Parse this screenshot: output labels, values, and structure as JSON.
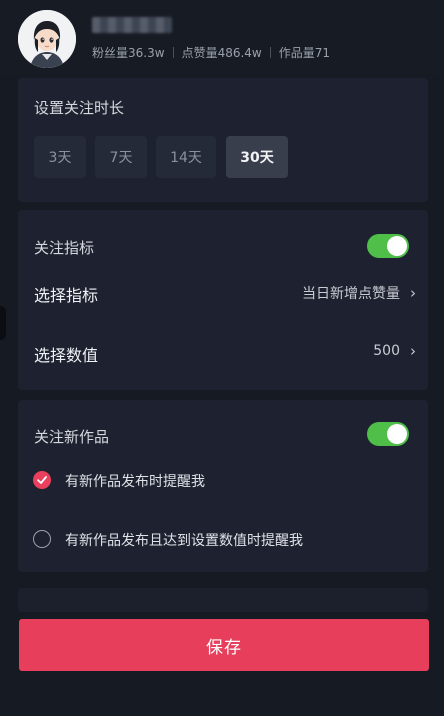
{
  "profile": {
    "stats": [
      {
        "label": "粉丝量",
        "value": "36.3w"
      },
      {
        "label": "点赞量",
        "value": "486.4w"
      },
      {
        "label": "作品量",
        "value": "71"
      }
    ]
  },
  "duration": {
    "title": "设置关注时长",
    "options": [
      "3天",
      "7天",
      "14天",
      "30天"
    ],
    "selected": "30天"
  },
  "metric": {
    "toggle_label": "关注指标",
    "toggle_on": true,
    "select_label": "选择指标",
    "select_value": "当日新增点赞量",
    "value_label": "选择数值",
    "value_value": "500"
  },
  "new_works": {
    "toggle_label": "关注新作品",
    "toggle_on": true,
    "options": [
      {
        "label": "有新作品发布时提醒我",
        "checked": true
      },
      {
        "label": "有新作品发布且达到设置数值时提醒我",
        "checked": false
      }
    ]
  },
  "actions": {
    "save_label": "保存"
  },
  "colors": {
    "accent": "#e63e5b",
    "toggle_on": "#4fbf4a",
    "background": "#161a23",
    "card": "#1e2230"
  },
  "icons": {
    "chevron": "chevron-right-icon",
    "check": "check-icon"
  }
}
